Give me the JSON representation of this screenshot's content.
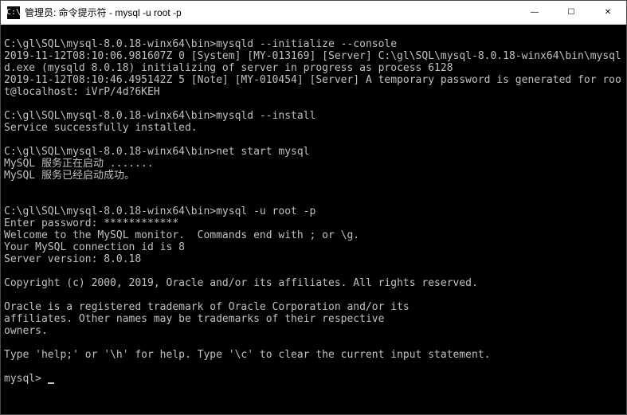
{
  "window": {
    "icon_text": "C:\\",
    "title": "管理员: 命令提示符 - mysql  -u root -p",
    "minimize": "—",
    "maximize": "☐",
    "close": "✕"
  },
  "terminal": {
    "lines": [
      "",
      "C:\\gl\\SQL\\mysql-8.0.18-winx64\\bin>mysqld --initialize --console",
      "2019-11-12T08:10:06.981607Z 0 [System] [MY-013169] [Server] C:\\gl\\SQL\\mysql-8.0.18-winx64\\bin\\mysqld.exe (mysqld 8.0.18) initializing of server in progress as process 6128",
      "2019-11-12T08:10:46.495142Z 5 [Note] [MY-010454] [Server] A temporary password is generated for root@localhost: iVrP/4d?6KEH",
      "",
      "C:\\gl\\SQL\\mysql-8.0.18-winx64\\bin>mysqld --install",
      "Service successfully installed.",
      "",
      "C:\\gl\\SQL\\mysql-8.0.18-winx64\\bin>net start mysql",
      "MySQL 服务正在启动 .......",
      "MySQL 服务已经启动成功。",
      "",
      "",
      "C:\\gl\\SQL\\mysql-8.0.18-winx64\\bin>mysql -u root -p",
      "Enter password: ************",
      "Welcome to the MySQL monitor.  Commands end with ; or \\g.",
      "Your MySQL connection id is 8",
      "Server version: 8.0.18",
      "",
      "Copyright (c) 2000, 2019, Oracle and/or its affiliates. All rights reserved.",
      "",
      "Oracle is a registered trademark of Oracle Corporation and/or its",
      "affiliates. Other names may be trademarks of their respective",
      "owners.",
      "",
      "Type 'help;' or '\\h' for help. Type '\\c' to clear the current input statement.",
      "",
      "mysql> "
    ]
  }
}
